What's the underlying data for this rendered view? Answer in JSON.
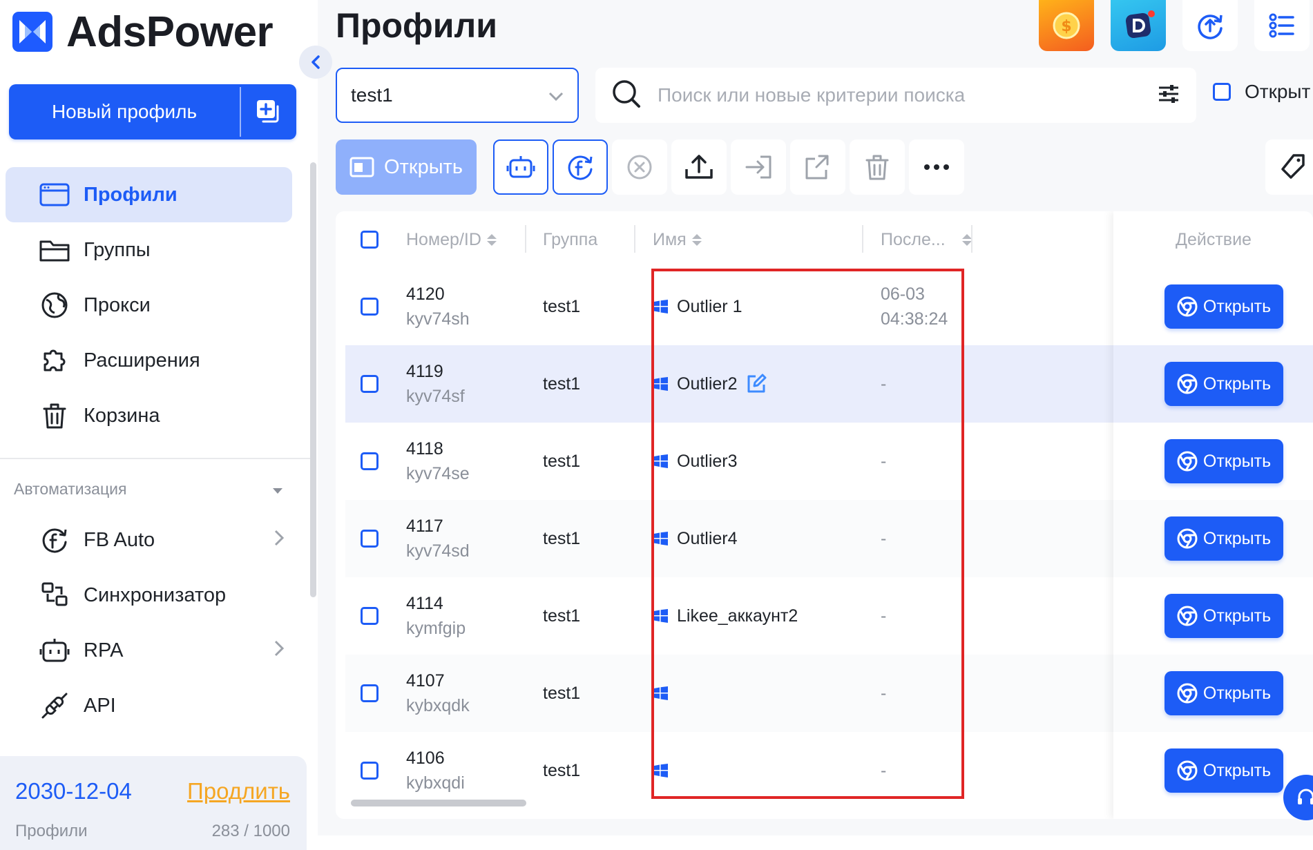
{
  "app": {
    "brand": "AdsPower",
    "accent": "#1d5cf6"
  },
  "sidebar": {
    "new_profile_label": "Новый профиль",
    "items": [
      {
        "label": "Профили",
        "icon": "profiles-icon",
        "active": true
      },
      {
        "label": "Группы",
        "icon": "folder-icon"
      },
      {
        "label": "Прокси",
        "icon": "globe-icon"
      },
      {
        "label": "Расширения",
        "icon": "puzzle-icon"
      },
      {
        "label": "Корзина",
        "icon": "trash-icon"
      }
    ],
    "automation_header": "Автоматизация",
    "automation_items": [
      {
        "label": "FB Auto",
        "icon": "facebook-refresh-icon",
        "has_chevron": true
      },
      {
        "label": "Синхронизатор",
        "icon": "sync-icon",
        "has_chevron": false
      },
      {
        "label": "RPA",
        "icon": "robot-icon",
        "has_chevron": true
      },
      {
        "label": "API",
        "icon": "plug-icon",
        "has_chevron": false
      }
    ],
    "plan": {
      "expiry": "2030-12-04",
      "renew_label": "Продлить",
      "profiles_label": "Профили",
      "profiles_count": "283 / 1000"
    }
  },
  "main": {
    "title": "Профили",
    "group_select": {
      "value": "test1"
    },
    "search": {
      "placeholder": "Поиск или новые критерии поиска"
    },
    "open_filter_label": "Открыт",
    "toolbar": {
      "open_label": "Открыть"
    },
    "table": {
      "columns": {
        "number": "Номер/ID",
        "group": "Группа",
        "name": "Имя",
        "last": "После...",
        "action": "Действие"
      },
      "open_button_label": "Открыть",
      "rows": [
        {
          "number": "4120",
          "id": "kyv74sh",
          "group": "test1",
          "name": "Outlier 1",
          "last_date": "06-03",
          "last_time": "04:38:24",
          "editing": false
        },
        {
          "number": "4119",
          "id": "kyv74sf",
          "group": "test1",
          "name": "Outlier2",
          "last_date": "-",
          "last_time": "",
          "editing": true
        },
        {
          "number": "4118",
          "id": "kyv74se",
          "group": "test1",
          "name": "Outlier3",
          "last_date": "-",
          "last_time": "",
          "editing": false
        },
        {
          "number": "4117",
          "id": "kyv74sd",
          "group": "test1",
          "name": "Outlier4",
          "last_date": "-",
          "last_time": "",
          "editing": false
        },
        {
          "number": "4114",
          "id": "kymfgip",
          "group": "test1",
          "name": "Likee_аккаунт2",
          "last_date": "-",
          "last_time": "",
          "editing": false
        },
        {
          "number": "4107",
          "id": "kybxqdk",
          "group": "test1",
          "name": "",
          "last_date": "-",
          "last_time": "",
          "editing": false
        },
        {
          "number": "4106",
          "id": "kybxqdi",
          "group": "test1",
          "name": "",
          "last_date": "-",
          "last_time": "",
          "editing": false
        }
      ]
    }
  }
}
